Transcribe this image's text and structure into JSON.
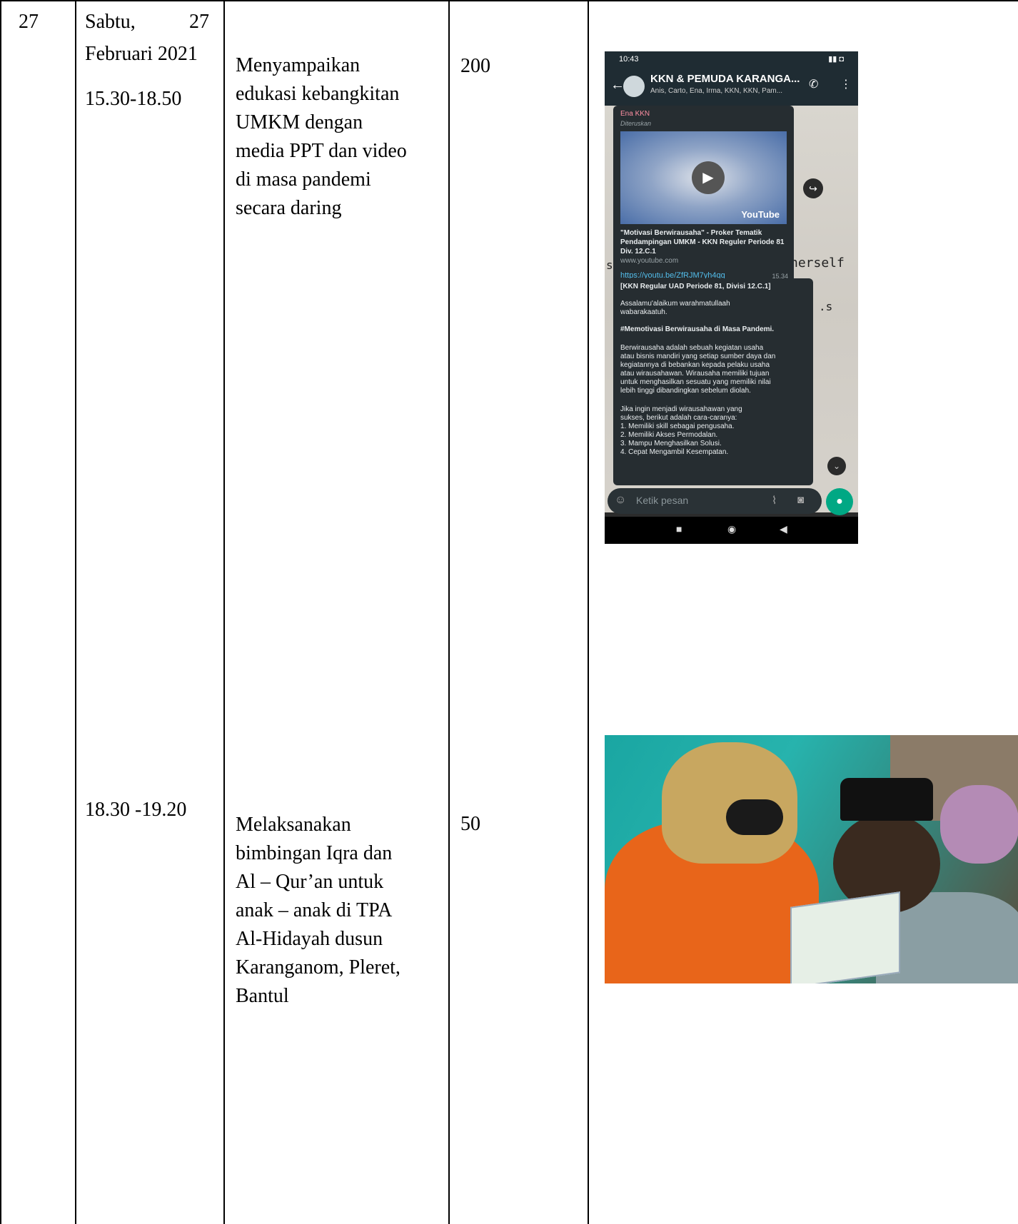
{
  "row": {
    "number": "27",
    "day": "Sabtu,",
    "day_num": "27",
    "month_year": "Februari 2021"
  },
  "activities": [
    {
      "time": "15.30-18.50",
      "description_lines": [
        "Menyampaikan",
        "edukasi kebangkitan",
        "UMKM dengan",
        "media PPT dan video",
        "di masa pandemi",
        "secara daring"
      ],
      "count": "200"
    },
    {
      "time": "18.30 -19.20",
      "description_lines": [
        "Melaksanakan",
        "bimbingan Iqra dan",
        "Al – Qur’an untuk",
        "anak – anak di TPA",
        "Al-Hidayah  dusun",
        "Karanganom, Pleret,",
        "Bantul"
      ],
      "count": "50"
    }
  ],
  "whatsapp": {
    "status_time": "10:43",
    "group_name": "KKN & PEMUDA KARANGA...",
    "members": "Anis, Carto, Ena, Irma, KKN, KKN, Pam...",
    "sender": "Ena KKN",
    "forwarded": "Diteruskan",
    "youtube_label": "YouTube",
    "video_title": "\"Motivasi Berwirausaha\" - Proker Tematik Pendampingan UMKM - KKN Reguler Periode 81 Div. 12.C.1",
    "video_domain": "www.youtube.com",
    "link": "https://youtu.be/ZfRJM7yh4qg",
    "msg_time": "15.34",
    "bg_text_left": "s",
    "bg_text_right": "nerself",
    "bg_text_right2": ".s",
    "message_lines": [
      "[KKN Regular UAD Periode 81, Divisi 12.C.1]",
      "",
      "Assalamu'alaikum warahmatullaah",
      "wabarakaatuh.",
      "",
      "#Memotivasi Berwirausaha di Masa Pandemi.",
      "",
      "Berwirausaha adalah sebuah kegiatan usaha",
      "atau bisnis mandiri yang setiap sumber daya dan",
      "kegiatannya di bebankan kepada pelaku usaha",
      "atau wirausahawan. Wirausaha memiliki tujuan",
      "untuk menghasilkan sesuatu yang memiliki nilai",
      "lebih tinggi dibandingkan sebelum diolah.",
      "",
      "Jika ingin menjadi wirausahawan yang",
      "sukses, berikut adalah cara-caranya:",
      "1. Memiliki skill sebagai pengusaha.",
      "2. Memiliki Akses Permodalan.",
      "3. Mampu Menghasilkan Solusi.",
      "4. Cepat Mengambil Kesempatan."
    ],
    "input_placeholder": "Ketik pesan"
  }
}
